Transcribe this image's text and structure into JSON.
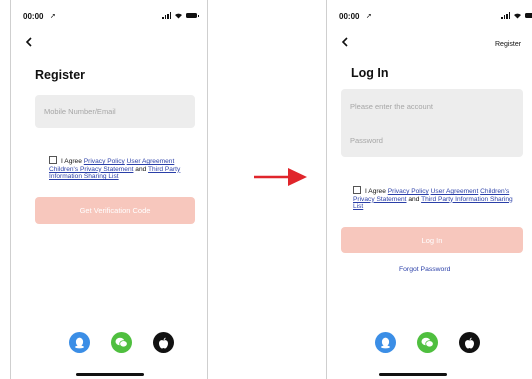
{
  "colors": {
    "primary_button": "#f7c7bd",
    "link": "#2a3fa8",
    "field_background": "#ededed",
    "qq": "#3b8ee6",
    "wechat": "#4fbf3f",
    "apple": "#111111",
    "flow_arrow": "#e0252b"
  },
  "register_screen": {
    "status_time": "00:00",
    "title": "Register",
    "account_placeholder": "Mobile Number/Email",
    "agreement": {
      "prefix": "I Agree",
      "privacy_policy": "Privacy Policy",
      "user_agreement": "User Agreement",
      "children_privacy": "Children's Privacy Statement",
      "and": "and",
      "third_party": "Third Party Information Sharing List"
    },
    "button_label": "Get Verification Code",
    "social_icons": [
      "qq-icon",
      "wechat-icon",
      "apple-icon"
    ]
  },
  "login_screen": {
    "status_time": "00:00",
    "nav_link": "Register",
    "title": "Log In",
    "account_placeholder": "Please enter the account",
    "password_placeholder": "Password",
    "agreement": {
      "prefix": "I Agree",
      "privacy_policy": "Privacy Policy",
      "user_agreement": "User Agreement",
      "children_privacy": "Children's Privacy Statement",
      "and": "and",
      "third_party": "Third Party Information Sharing List"
    },
    "button_label": "Log In",
    "forgot_password": "Forgot Password",
    "social_icons": [
      "qq-icon",
      "wechat-icon",
      "apple-icon"
    ]
  }
}
